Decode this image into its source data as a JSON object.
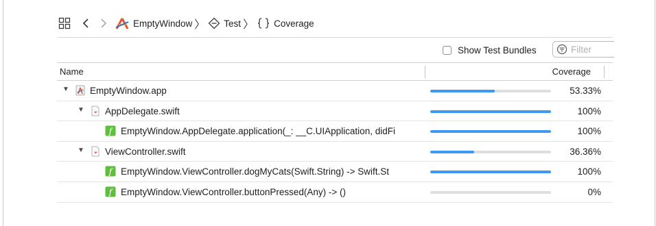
{
  "jumpbar": {
    "grid_icon": "related-items-grid-icon",
    "back_icon": "chevron-left-icon",
    "forward_icon": "chevron-right-icon",
    "crumbs": [
      {
        "label": "EmptyWindow",
        "icon": "xcode-app-icon"
      },
      {
        "label": "Test",
        "icon": "test-diamond-icon"
      },
      {
        "label": "Coverage",
        "icon": "braces-icon"
      }
    ],
    "separator": "〉"
  },
  "toolbar": {
    "show_test_bundles_label": "Show Test Bundles",
    "show_test_bundles_checked": false,
    "filter_placeholder": "Filter",
    "filter_icon": "filter-icon"
  },
  "table": {
    "columns": {
      "name": "Name",
      "coverage": "Coverage"
    },
    "rows": [
      {
        "label": "EmptyWindow.app",
        "coverage_text": "53.33%",
        "coverage": 0.5333,
        "icon": "app-icon",
        "level": 0,
        "disclosure": true
      },
      {
        "label": "AppDelegate.swift",
        "coverage_text": "100%",
        "coverage": 1.0,
        "icon": "swift-file-icon",
        "level": 1,
        "disclosure": true
      },
      {
        "label": "EmptyWindow.AppDelegate.application(_: __C.UIApplication, didFi",
        "coverage_text": "100%",
        "coverage": 1.0,
        "icon": "function-icon",
        "level": 2,
        "disclosure": false
      },
      {
        "label": "ViewController.swift",
        "coverage_text": "36.36%",
        "coverage": 0.3636,
        "icon": "swift-file-icon",
        "level": 1,
        "disclosure": true
      },
      {
        "label": "EmptyWindow.ViewController.dogMyCats(Swift.String) -> Swift.St",
        "coverage_text": "100%",
        "coverage": 1.0,
        "icon": "function-icon",
        "level": 2,
        "disclosure": false
      },
      {
        "label": "EmptyWindow.ViewController.buttonPressed(Any) -> ()",
        "coverage_text": "0%",
        "coverage": 0.0,
        "icon": "function-icon",
        "level": 2,
        "disclosure": false
      }
    ]
  },
  "colors": {
    "bar_fill": "#3b99f3",
    "bar_track": "#dedede",
    "function_icon": "#5fbf3c",
    "swift_orange": "#f05138"
  }
}
